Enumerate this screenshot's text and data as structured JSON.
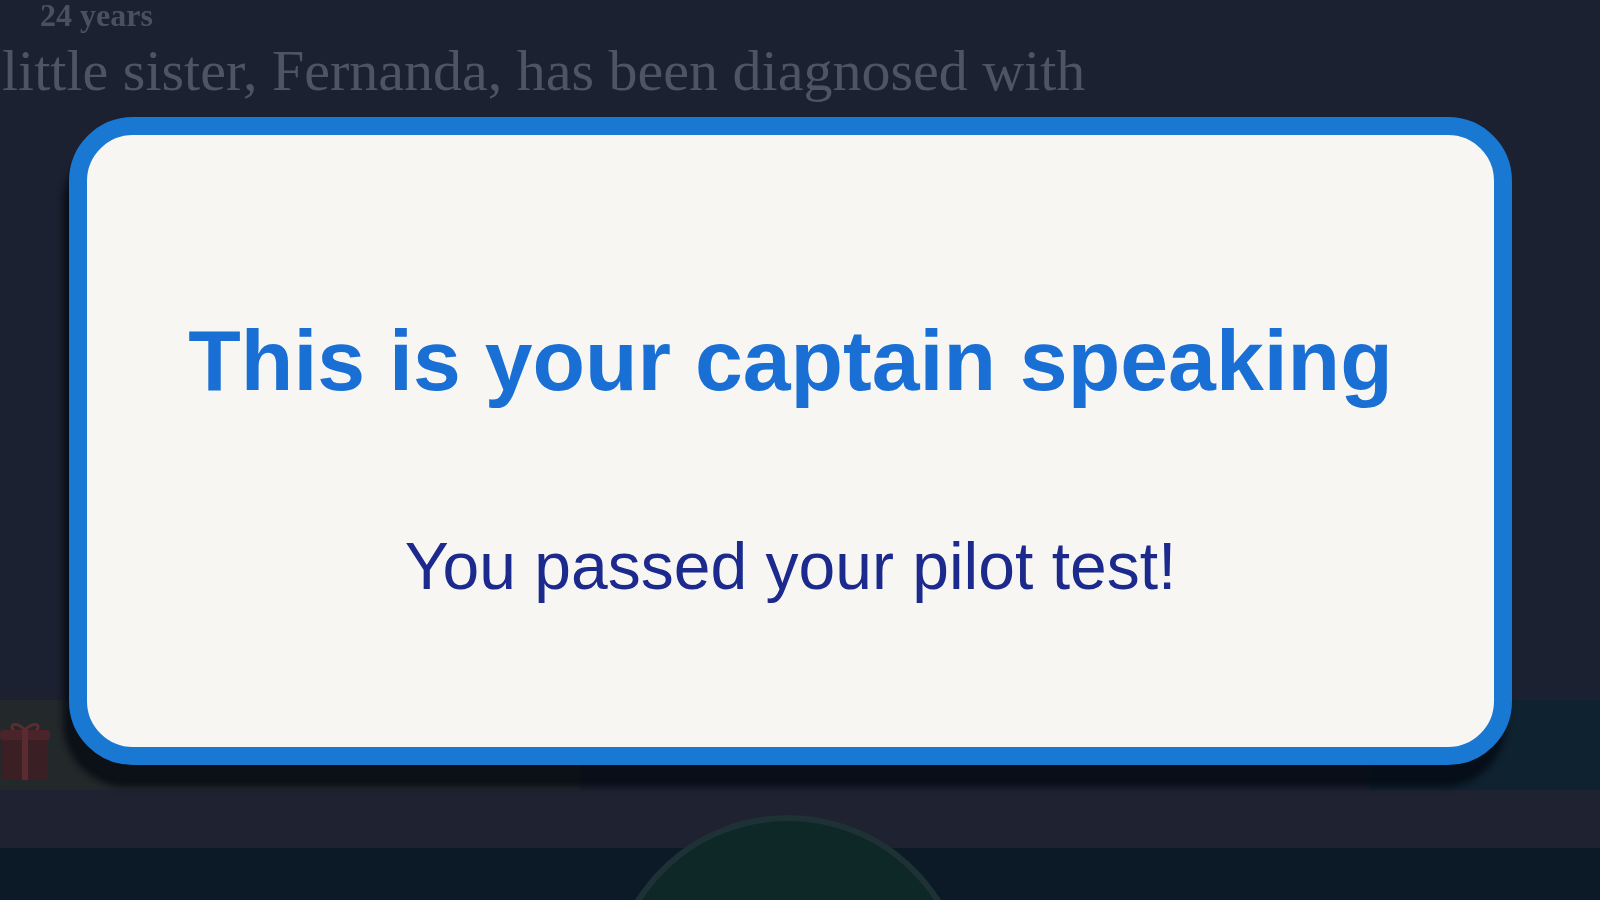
{
  "background": {
    "heading": "24 years",
    "paragraph": "little sister, Fernanda, has been diagnosed with"
  },
  "dialog": {
    "title": "This is your captain speaking",
    "message": "You passed your pilot test!"
  }
}
